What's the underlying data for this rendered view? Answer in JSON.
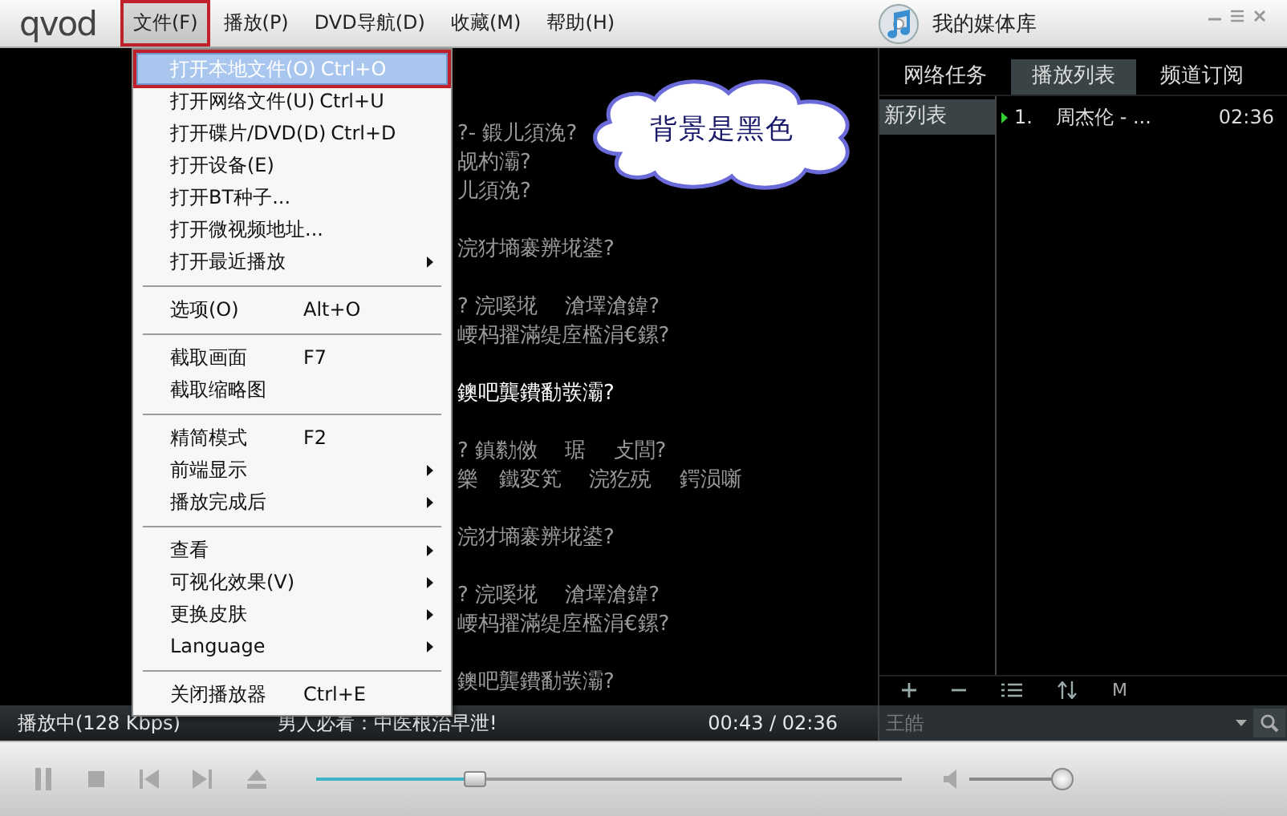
{
  "title_bar": {
    "logo": "qvod",
    "menus": [
      {
        "label": "文件(F)",
        "selected": true,
        "marked": true
      },
      {
        "label": "播放(P)",
        "selected": false,
        "marked": false
      },
      {
        "label": "DVD导航(D)",
        "selected": false,
        "marked": false
      },
      {
        "label": "收藏(M)",
        "selected": false,
        "marked": false
      },
      {
        "label": "帮助(H)",
        "selected": false,
        "marked": false
      }
    ],
    "library_title": "我的媒体库"
  },
  "file_menu": [
    {
      "kind": "item",
      "label": "打开本地文件(O)",
      "shortcut": "Ctrl+O",
      "submenu": false,
      "selected": true,
      "marked": true
    },
    {
      "kind": "item",
      "label": "打开网络文件(U)",
      "shortcut": "Ctrl+U",
      "submenu": false,
      "selected": false,
      "marked": false
    },
    {
      "kind": "item",
      "label": "打开碟片/DVD(D)",
      "shortcut": "Ctrl+D",
      "submenu": false,
      "selected": false,
      "marked": false
    },
    {
      "kind": "item",
      "label": "打开设备(E)",
      "submenu": false,
      "selected": false,
      "marked": false
    },
    {
      "kind": "item",
      "label": "打开BT种子...",
      "submenu": false,
      "selected": false,
      "marked": false
    },
    {
      "kind": "item",
      "label": "打开微视频地址...",
      "submenu": false,
      "selected": false,
      "marked": false
    },
    {
      "kind": "item",
      "label": "打开最近播放",
      "submenu": true,
      "selected": false,
      "marked": false
    },
    {
      "kind": "separator"
    },
    {
      "kind": "item",
      "label": "选项(O)",
      "shortcut": "Alt+O",
      "submenu": false,
      "selected": false,
      "marked": false
    },
    {
      "kind": "separator"
    },
    {
      "kind": "item",
      "label": "截取画面",
      "shortcut": "F7",
      "submenu": false,
      "selected": false,
      "marked": false
    },
    {
      "kind": "item",
      "label": "截取缩略图",
      "submenu": false,
      "selected": false,
      "marked": false
    },
    {
      "kind": "separator"
    },
    {
      "kind": "item",
      "label": "精简模式",
      "shortcut": "F2",
      "submenu": false,
      "selected": false,
      "marked": false
    },
    {
      "kind": "item",
      "label": "前端显示",
      "submenu": true,
      "selected": false,
      "marked": false
    },
    {
      "kind": "item",
      "label": "播放完成后",
      "submenu": true,
      "selected": false,
      "marked": false
    },
    {
      "kind": "separator"
    },
    {
      "kind": "item",
      "label": "查看",
      "submenu": true,
      "selected": false,
      "marked": false
    },
    {
      "kind": "item",
      "label": "可视化效果(V)",
      "submenu": true,
      "selected": false,
      "marked": false
    },
    {
      "kind": "item",
      "label": "更换皮肤",
      "submenu": true,
      "selected": false,
      "marked": false
    },
    {
      "kind": "item",
      "label": "Language",
      "submenu": true,
      "selected": false,
      "marked": false
    },
    {
      "kind": "separator"
    },
    {
      "kind": "item",
      "label": "关闭播放器",
      "shortcut": "Ctrl+E",
      "submenu": false,
      "selected": false,
      "marked": false
    }
  ],
  "video": {
    "lyrics": [
      [
        {
          "text": "?- 鍛儿須浼?",
          "current": false
        },
        {
          "text": "觇杓灞?",
          "current": false
        },
        {
          "text": "儿須浼?",
          "current": false
        }
      ],
      [
        {
          "text": "浣犲墒褰辨埖鍙?",
          "current": false
        }
      ],
      [
        {
          "text": "? 浣嗘埖　 滄墿滄鍏?",
          "current": false
        },
        {
          "text": "崾杩擢滿缇庢檻涓€鏍?",
          "current": false
        }
      ],
      [
        {
          "text": "鐭吧龔鐨勫彂灞?",
          "current": true
        }
      ],
      [
        {
          "text": "? 鎮勬傚　 琚　 攴閭?",
          "current": false
        },
        {
          "text": "樂　鐵変笂　 浣犵殑　 鍔涢噺",
          "current": false
        }
      ],
      [
        {
          "text": "浣犲墒褰辨埖鍙?",
          "current": false
        }
      ],
      [
        {
          "text": "? 浣嗘埖　 滄墿滄鍏?",
          "current": false
        },
        {
          "text": "崾杩擢滿缇庢檻涓€鏍?",
          "current": false
        }
      ],
      [
        {
          "text": "鐭吧龔鐨勫彂灞?",
          "current": false
        }
      ]
    ]
  },
  "callout": "背景是黑色",
  "library": {
    "tabs": [
      {
        "label": "网络任务",
        "selected": false
      },
      {
        "label": "播放列表",
        "selected": true
      },
      {
        "label": "频道订阅",
        "selected": false
      }
    ],
    "lists": [
      {
        "label": "新列表",
        "selected": true
      }
    ],
    "entries": [
      {
        "number": "1.",
        "title": "周杰伦 - ...",
        "duration": "02:36",
        "playing": true
      }
    ],
    "toolbar": [
      {
        "kind": "add"
      },
      {
        "kind": "remove"
      },
      {
        "kind": "list"
      },
      {
        "kind": "sort"
      },
      {
        "kind": "text",
        "label": "M"
      }
    ]
  },
  "status_bar": {
    "state": "播放中(128 Kbps)",
    "ad": "男人必看：中医根治早泄!",
    "time": "00:43 / 02:36"
  },
  "search": {
    "value": "王皓"
  },
  "controls": {
    "transport": [
      {
        "kind": "pause"
      },
      {
        "kind": "stop"
      },
      {
        "kind": "previous"
      },
      {
        "kind": "next"
      },
      {
        "kind": "eject"
      }
    ],
    "seek": {
      "level": 0.27
    },
    "volume": {
      "level": 1.0
    }
  }
}
